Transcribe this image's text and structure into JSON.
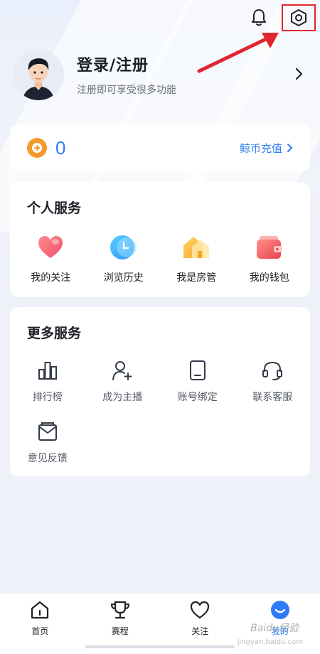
{
  "profile": {
    "title": "登录/注册",
    "subtitle": "注册即可享受很多功能"
  },
  "header": {
    "icons": [
      "bell-icon",
      "settings-icon"
    ]
  },
  "wallet": {
    "coin_count": "0",
    "recharge_label": "鲸币充值"
  },
  "personal_services": {
    "title": "个人服务",
    "items": [
      {
        "label": "我的关注",
        "icon": "heart-icon"
      },
      {
        "label": "浏览历史",
        "icon": "clock-icon"
      },
      {
        "label": "我是房管",
        "icon": "house-icon"
      },
      {
        "label": "我的钱包",
        "icon": "wallet-icon"
      }
    ]
  },
  "more_services": {
    "title": "更多服务",
    "items": [
      {
        "label": "排行榜",
        "icon": "ranking-icon"
      },
      {
        "label": "成为主播",
        "icon": "add-user-icon"
      },
      {
        "label": "账号绑定",
        "icon": "tablet-icon"
      },
      {
        "label": "联系客服",
        "icon": "headset-icon"
      },
      {
        "label": "意见反馈",
        "icon": "feedback-icon"
      }
    ]
  },
  "tabbar": {
    "tabs": [
      {
        "label": "首页",
        "icon": "home-icon"
      },
      {
        "label": "赛程",
        "icon": "trophy-icon"
      },
      {
        "label": "关注",
        "icon": "heart-outline-icon"
      },
      {
        "label": "我的",
        "icon": "profile-icon"
      }
    ],
    "active_index": 3
  },
  "watermark": {
    "text": "Baidu经验",
    "sub": "jingyan.baidu.com"
  },
  "colors": {
    "accent": "#2f7cf6",
    "highlight_box": "#e0262f",
    "coin": "#f29a2e"
  }
}
